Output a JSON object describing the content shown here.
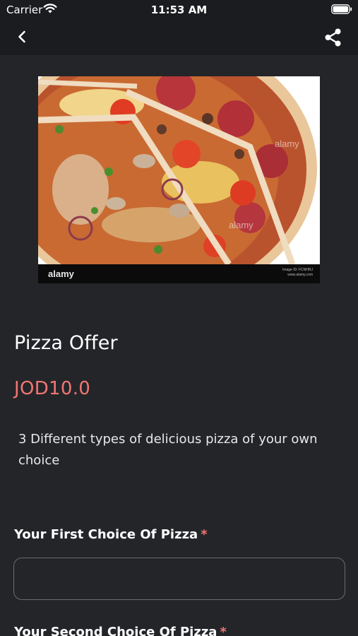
{
  "status_bar": {
    "carrier": "Carrier",
    "time": "11:53 AM"
  },
  "nav": {
    "back_icon": "chevron-left-icon",
    "share_icon": "share-icon"
  },
  "hero_image": {
    "watermark_logo": "alamy",
    "watermark_id": "Image ID: FCNHRJ",
    "watermark_url": "www.alamy.com"
  },
  "product": {
    "title": "Pizza Offer",
    "price": "JOD10.0",
    "description": "3 Different types of delicious pizza of your own choice"
  },
  "form": {
    "first_choice": {
      "label": "Your First Choice Of Pizza",
      "required_mark": "*",
      "value": ""
    },
    "second_choice": {
      "label": "Your Second Choice Of Pizza",
      "required_mark": "*"
    }
  },
  "colors": {
    "background": "#242529",
    "top_bar": "#1b1c1f",
    "accent": "#f07673"
  }
}
